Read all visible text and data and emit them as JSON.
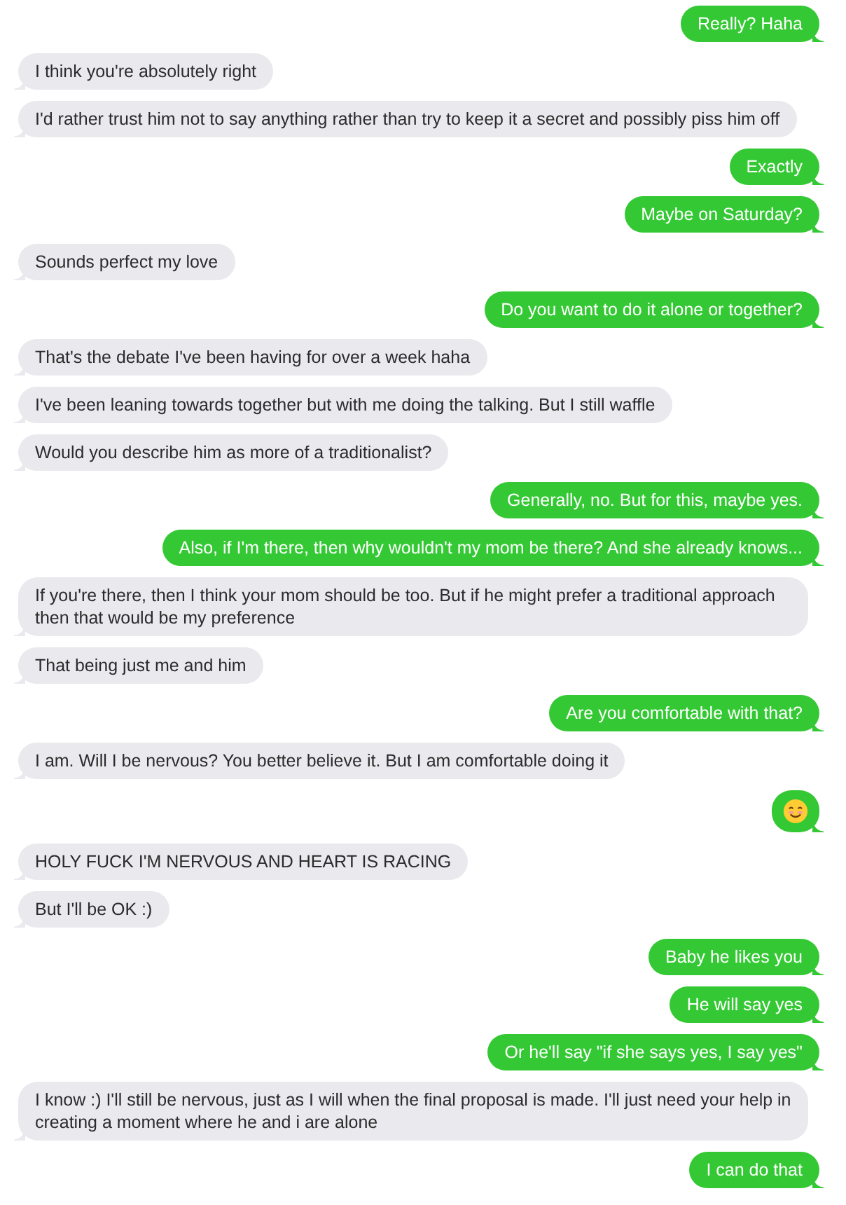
{
  "messages": [
    {
      "sent": true,
      "kind": "text",
      "text": "Really? Haha"
    },
    {
      "sent": false,
      "kind": "text",
      "text": "I think you're absolutely right"
    },
    {
      "sent": false,
      "kind": "text",
      "text": "I'd rather trust him not to say anything rather than try to keep it a secret and possibly piss him off"
    },
    {
      "sent": true,
      "kind": "text",
      "text": "Exactly"
    },
    {
      "sent": true,
      "kind": "text",
      "text": "Maybe on Saturday?"
    },
    {
      "sent": false,
      "kind": "text",
      "text": "Sounds perfect my love"
    },
    {
      "sent": true,
      "kind": "text",
      "text": "Do you want to do it alone or together?"
    },
    {
      "sent": false,
      "kind": "text",
      "text": "That's the debate I've been having for over a week haha"
    },
    {
      "sent": false,
      "kind": "text",
      "text": "I've been leaning towards together but with me doing the talking. But I still waffle"
    },
    {
      "sent": false,
      "kind": "text",
      "text": "Would you describe him as more of a traditionalist?"
    },
    {
      "sent": true,
      "kind": "text",
      "text": "Generally, no. But for this, maybe yes."
    },
    {
      "sent": true,
      "kind": "text",
      "text": "Also, if I'm there, then why wouldn't my mom be there? And she already knows..."
    },
    {
      "sent": false,
      "kind": "text",
      "text": "If you're there, then I think your mom should be too. But if he might prefer a traditional approach then that would be my preference"
    },
    {
      "sent": false,
      "kind": "text",
      "text": "That being just me and him"
    },
    {
      "sent": true,
      "kind": "text",
      "text": "Are you comfortable with that?"
    },
    {
      "sent": false,
      "kind": "text",
      "text": "I am. Will I be nervous? You better believe it. But I am comfortable doing it"
    },
    {
      "sent": true,
      "kind": "emoji"
    },
    {
      "sent": false,
      "kind": "text",
      "text": "HOLY FUCK I'M NERVOUS AND HEART IS RACING"
    },
    {
      "sent": false,
      "kind": "text",
      "text": "But I'll be OK :)"
    },
    {
      "sent": true,
      "kind": "text",
      "text": "Baby he likes you"
    },
    {
      "sent": true,
      "kind": "text",
      "text": "He will say yes"
    },
    {
      "sent": true,
      "kind": "text",
      "text": "Or he'll say \"if she says yes, I say yes\""
    },
    {
      "sent": false,
      "kind": "text",
      "text": "I know :) I'll still be nervous, just as I will when the final proposal is made. I'll just need your help in creating a moment where he and i are alone"
    },
    {
      "sent": true,
      "kind": "text",
      "text": "I can do that"
    }
  ]
}
